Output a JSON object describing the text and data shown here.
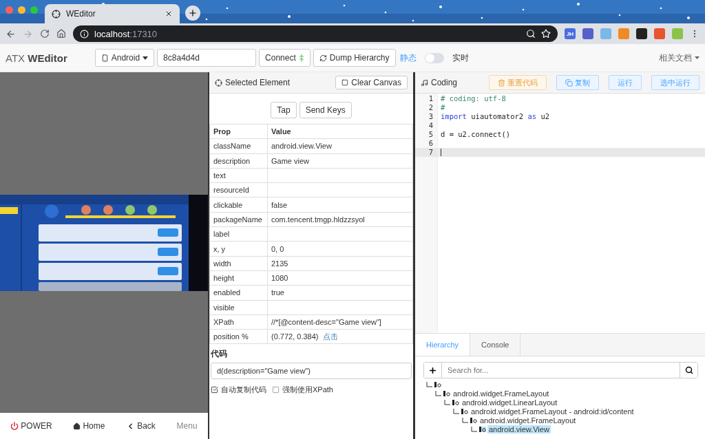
{
  "browser": {
    "tab_title": "WEditor",
    "url_host": "localhost",
    "url_port": ":17310",
    "extension_badge": "JH"
  },
  "header": {
    "brand_light": "ATX",
    "brand_bold": "WEditor",
    "platform": "Android",
    "serial": "8c8a4d4d",
    "connect": "Connect",
    "dump": "Dump Hierarchy",
    "mode_static": "静态",
    "mode_live": "实时",
    "live": false,
    "docs": "相关文档"
  },
  "device": {
    "buttons": [
      {
        "kind": "power",
        "label": "POWER"
      },
      {
        "kind": "home",
        "label": "Home"
      },
      {
        "kind": "back",
        "label": "Back"
      },
      {
        "kind": "menu",
        "label": "Menu"
      }
    ]
  },
  "inspector": {
    "title": "Selected Element",
    "clear_button": "Clear Canvas",
    "actions": [
      "Tap",
      "Send Keys"
    ],
    "columns": [
      "Prop",
      "Value"
    ],
    "rows": [
      {
        "prop": "className",
        "value": "android.view.View"
      },
      {
        "prop": "description",
        "value": "Game view"
      },
      {
        "prop": "text"
      },
      {
        "prop": "resourceId"
      },
      {
        "prop": "clickable",
        "value": "false"
      },
      {
        "prop": "packageName",
        "value": "com.tencent.tmgp.hldzzsyol"
      },
      {
        "prop": "label"
      },
      {
        "prop": "x, y",
        "value": "0, 0"
      },
      {
        "prop": "width",
        "value": "2135"
      },
      {
        "prop": "height",
        "value": "1080"
      },
      {
        "prop": "enabled",
        "value": "true"
      },
      {
        "prop": "visible"
      },
      {
        "prop": "XPath",
        "value": "//*[@content-desc=\"Game view\"]"
      },
      {
        "prop": "position %",
        "value": "(0.772, 0.384)",
        "link": "点击"
      }
    ],
    "code_label": "代码",
    "code_value": "d(description=\"Game view\")",
    "options": [
      {
        "label": "自动复制代码",
        "checked": true
      },
      {
        "label": "强制使用XPath",
        "checked": false
      }
    ]
  },
  "coding": {
    "title": "Coding",
    "buttons": [
      {
        "kind": "reset",
        "label": "重置代码"
      },
      {
        "kind": "copy",
        "label": "复制"
      },
      {
        "kind": "run",
        "label": "运行"
      },
      {
        "kind": "run_selected",
        "label": "选中运行"
      }
    ],
    "lines": [
      {
        "number": "1",
        "current": false,
        "tokens": [
          {
            "kind": "comment",
            "text": "# coding: utf-8"
          }
        ]
      },
      {
        "number": "2",
        "current": false,
        "tokens": [
          {
            "kind": "comment",
            "text": "#"
          }
        ]
      },
      {
        "number": "3",
        "current": false,
        "tokens": [
          {
            "kind": "keyword",
            "text": "import"
          },
          {
            "kind": "plain",
            "text": " uiautomator2 "
          },
          {
            "kind": "keyword",
            "text": "as"
          },
          {
            "kind": "plain",
            "text": " u2"
          }
        ]
      },
      {
        "number": "4",
        "current": false
      },
      {
        "number": "5",
        "current": false,
        "tokens": [
          {
            "kind": "plain",
            "text": "d = u2.connect()"
          }
        ]
      },
      {
        "number": "6",
        "current": false
      },
      {
        "number": "7",
        "current": true
      }
    ]
  },
  "bottom_tabs": [
    {
      "label": "Hierarchy",
      "selected": true
    },
    {
      "label": "Console",
      "selected": false
    }
  ],
  "hierarchy": {
    "search_placeholder": "Search for...",
    "tree": [
      {
        "selected": false,
        "children": [
          {
            "label": "android.widget.FrameLayout",
            "selected": false,
            "children": [
              {
                "label": "android.widget.LinearLayout",
                "selected": false,
                "children": [
                  {
                    "label": "android.widget.FrameLayout - android:id/content",
                    "selected": false,
                    "children": [
                      {
                        "label": "android.widget.FrameLayout",
                        "selected": false,
                        "children": [
                          {
                            "label": "android.view.View",
                            "selected": true
                          }
                        ]
                      }
                    ]
                  }
                ]
              }
            ]
          }
        ]
      }
    ]
  }
}
